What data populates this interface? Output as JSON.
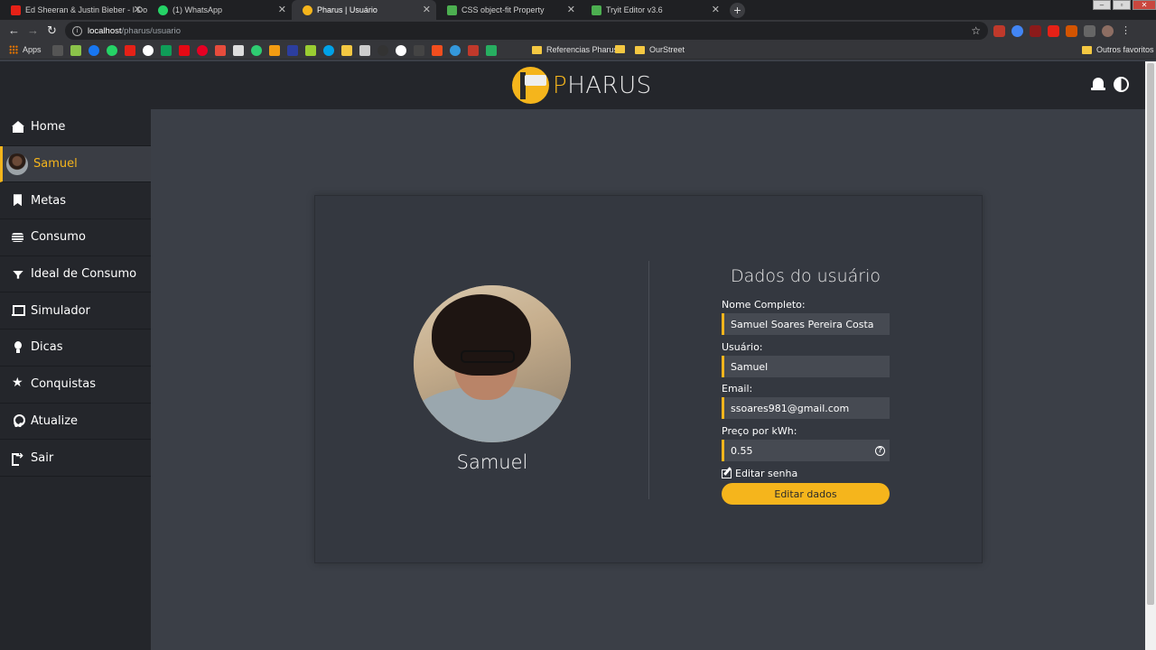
{
  "browser": {
    "tabs": [
      {
        "title": "Ed Sheeran & Justin Bieber - I Do",
        "favicon_color": "#e62117",
        "active": false
      },
      {
        "title": "(1) WhatsApp",
        "favicon_color": "#25d366",
        "active": false
      },
      {
        "title": "Pharus | Usuário",
        "favicon_color": "#f5b51c",
        "active": true
      },
      {
        "title": "CSS object-fit Property",
        "favicon_color": "#4caf50",
        "active": false
      },
      {
        "title": "Tryit Editor v3.6",
        "favicon_color": "#4caf50",
        "active": false
      }
    ],
    "url_host": "localhost",
    "url_path": "/pharus/usuario",
    "bookmarks": {
      "apps_label": "Apps",
      "folders": [
        "Referencias Pharus",
        "OurStreet",
        "Outros favoritos"
      ]
    }
  },
  "app": {
    "logo_text_accent": "P",
    "logo_text_rest": "HARUS",
    "accent_color": "#f5b51c",
    "sidebar": [
      {
        "label": "Home",
        "icon": "home-icon"
      },
      {
        "label": "Samuel",
        "icon": "avatar",
        "active": true
      },
      {
        "label": "Metas",
        "icon": "bookmark-icon"
      },
      {
        "label": "Consumo",
        "icon": "coins-icon"
      },
      {
        "label": "Ideal de Consumo",
        "icon": "plug-icon"
      },
      {
        "label": "Simulador",
        "icon": "laptop-icon"
      },
      {
        "label": "Dicas",
        "icon": "lightbulb-icon"
      },
      {
        "label": "Conquistas",
        "icon": "star-icon"
      },
      {
        "label": "Atualize",
        "icon": "award-icon"
      },
      {
        "label": "Sair",
        "icon": "sign-out-icon"
      }
    ],
    "profile": {
      "name": "Samuel"
    },
    "form": {
      "title": "Dados do usuário",
      "full_name_label": "Nome Completo:",
      "full_name_value": "Samuel Soares Pereira Costa",
      "user_label": "Usuário:",
      "user_value": "Samuel",
      "email_label": "Email:",
      "email_value": "ssoares981@gmail.com",
      "price_label": "Preço por kWh:",
      "price_value": "0.55",
      "edit_password": "Editar senha",
      "edit_button": "Editar dados"
    }
  }
}
